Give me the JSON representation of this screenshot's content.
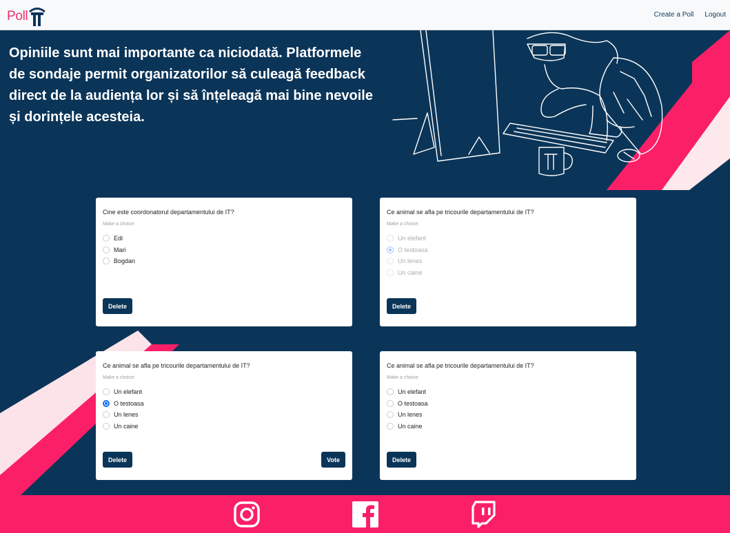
{
  "header": {
    "logo_poll": "Poll",
    "nav": {
      "create_poll": "Create a Poll",
      "logout": "Logout"
    }
  },
  "hero": {
    "text": "Opiniile sunt mai importante ca niciodată. Platformele de sondaje permit organizatorilor să culeagă feedback direct de la audiența lor și să înțeleagă mai bine nevoile și dorințele acesteia."
  },
  "polls": [
    {
      "question": "Cine este coordonatorul departamentului de IT?",
      "hint": "Make a choice:",
      "options": [
        "Edi",
        "Mari",
        "Bogdan"
      ],
      "delete_label": "Delete"
    },
    {
      "question": "Ce animal se afla pe tricourile departamentului de IT?",
      "hint": "Make a choice:",
      "options": [
        "Un elefant",
        "O testoasa",
        "Un lenes",
        "Un caine"
      ],
      "selected": "O testoasa",
      "disabled": true,
      "delete_label": "Delete"
    },
    {
      "question": "Ce animal se afla pe tricourile departamentului de IT?",
      "hint": "Make a choice:",
      "options": [
        "Un elefant",
        "O testoasa",
        "Un lenes",
        "Un caine"
      ],
      "selected": "O testoasa",
      "delete_label": "Delete",
      "vote_label": "Vote"
    },
    {
      "question": "Ce animal se afla pe tricourile departamentului de IT?",
      "hint": "Make a choice:",
      "options": [
        "Un elefant",
        "O testoasa",
        "Un lenes",
        "Un caine"
      ],
      "delete_label": "Delete"
    }
  ],
  "footer": {
    "icons": [
      "instagram-icon",
      "facebook-icon",
      "twitch-icon"
    ]
  },
  "colors": {
    "navy": "#0b3558",
    "pink": "#fb1f68",
    "accent": "#0d6efd"
  }
}
